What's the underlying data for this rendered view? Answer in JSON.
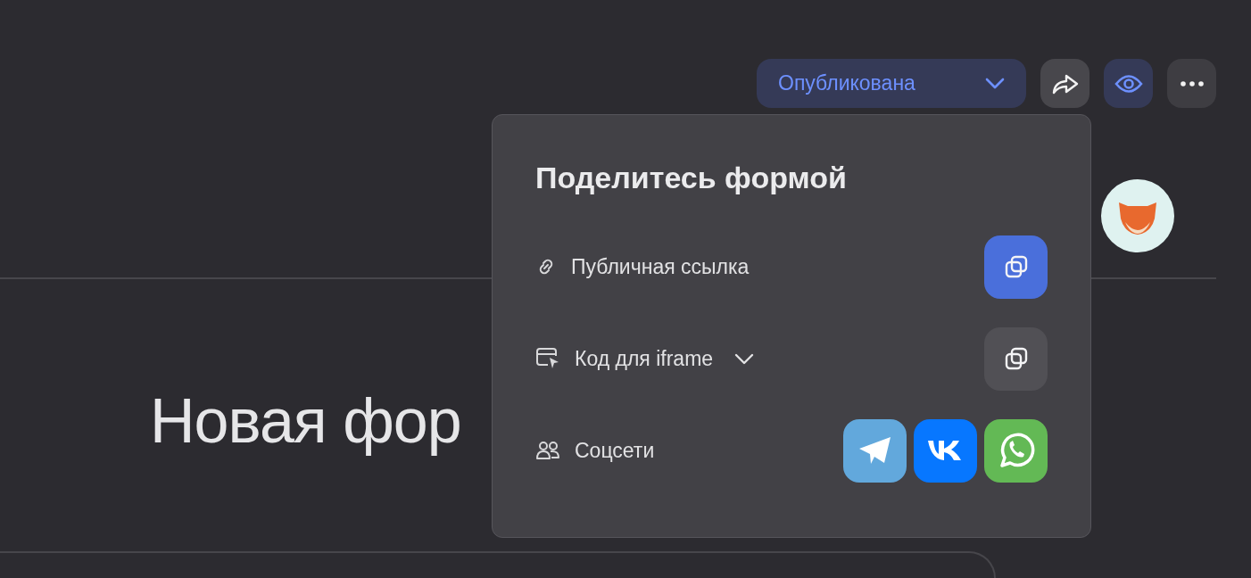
{
  "toolbar": {
    "status": {
      "label": "Опубликована"
    }
  },
  "share_popover": {
    "title": "Поделитесь формой",
    "rows": [
      {
        "kind": "link",
        "label": "Публичная ссылка",
        "primary": true
      },
      {
        "kind": "iframe",
        "label": "Код для iframe",
        "primary": false
      },
      {
        "kind": "social",
        "label": "Соцсети"
      }
    ]
  },
  "form": {
    "title": "Новая фор"
  }
}
